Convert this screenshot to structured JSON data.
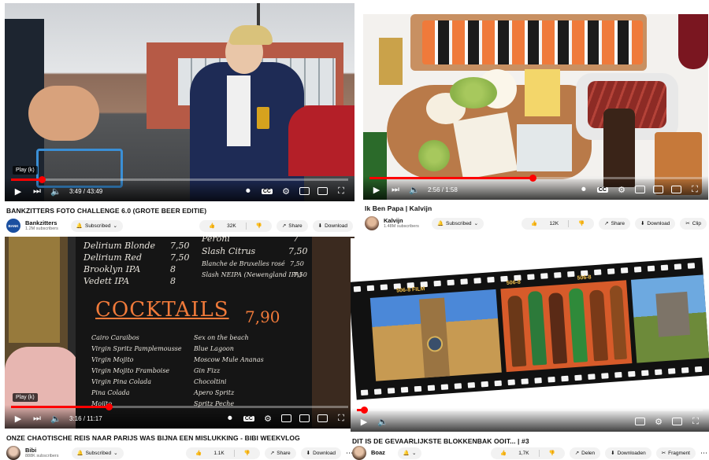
{
  "tiles": [
    {
      "title": "BANKZITTERS FOTO CHALLENGE 6.0 (GROTE BEER EDITIE)",
      "channel": "Bankzitters",
      "subscribers": "1.2M subscribers",
      "subscribed_label": "Subscribed",
      "likes": "32K",
      "share_label": "Share",
      "download_label": "Download",
      "time": "3:49 / 43:49",
      "tooltip": "Play (k)",
      "progress": 0.09,
      "avatar_text": "BANK"
    },
    {
      "title": "Ik Ben Papa | Kalvijn",
      "channel": "Kalvijn",
      "subscribers": "1.48M subscribers",
      "subscribed_label": "Subscribed",
      "likes": "12K",
      "share_label": "Share",
      "download_label": "Download",
      "clip_label": "Clip",
      "time": "2:56 / 1:58",
      "progress": 0.49
    },
    {
      "title": "ONZE CHAOTISCHE REIS NAAR PARIJS WAS BIJNA EEN MISLUKKING - BIBI WEEKVLOG",
      "channel": "Bibi",
      "subscribers": "888K subscribers",
      "subscribed_label": "Subscribed",
      "likes": "1.1K",
      "share_label": "Share",
      "download_label": "Download",
      "time": "3:16 / 11:17",
      "tooltip": "Play (k)",
      "progress": 0.29,
      "board": {
        "beers": [
          {
            "name": "Delirium Blonde",
            "price": "7,50"
          },
          {
            "name": "Delirium Red",
            "price": "7,50"
          },
          {
            "name": "Brooklyn IPA",
            "price": "8"
          },
          {
            "name": "Vedett IPA",
            "price": "8"
          }
        ],
        "beers_right": [
          {
            "name": "Peroni",
            "price": "7"
          },
          {
            "name": "Slash Citrus",
            "price": "7,50"
          },
          {
            "name": "Blanche de Bruxelles rosé",
            "price": "7,50"
          },
          {
            "name": "Slash NEIPA (Newengland IPA)",
            "price": "7,50"
          }
        ],
        "heading": "COCKTAILS",
        "heading_price": "7,90",
        "cocktails_left": [
          "Cairo Caraibos",
          "Virgin Spritz Pamplemousse",
          "Virgin Mojito",
          "Virgin Mojito Framboise",
          "Virgin Pina Colada",
          "Pina Colada",
          "Mojito"
        ],
        "cocktails_right": [
          "Sex on the beach",
          "Blue Lagoon",
          "Moscow Mule Ananas",
          "Gin Fizz",
          "Chocoltini",
          "Apero Spritz",
          "Spritz Peche"
        ]
      }
    },
    {
      "title": "DIT IS DE GEVAARLIJKSTE BLOKKENBAK OOIT... | #3",
      "channel": "Boaz",
      "subscribers": "",
      "likes": "1,7K",
      "share_label": "Delen",
      "download_label": "Downloaden",
      "clip_label": "Fragment",
      "film_labels": [
        "506-8 FILM",
        "506-8",
        "506-8"
      ],
      "progress": 0.02
    }
  ],
  "colors": {
    "accent": "#ff0000",
    "pill": "#f2f2f2"
  }
}
